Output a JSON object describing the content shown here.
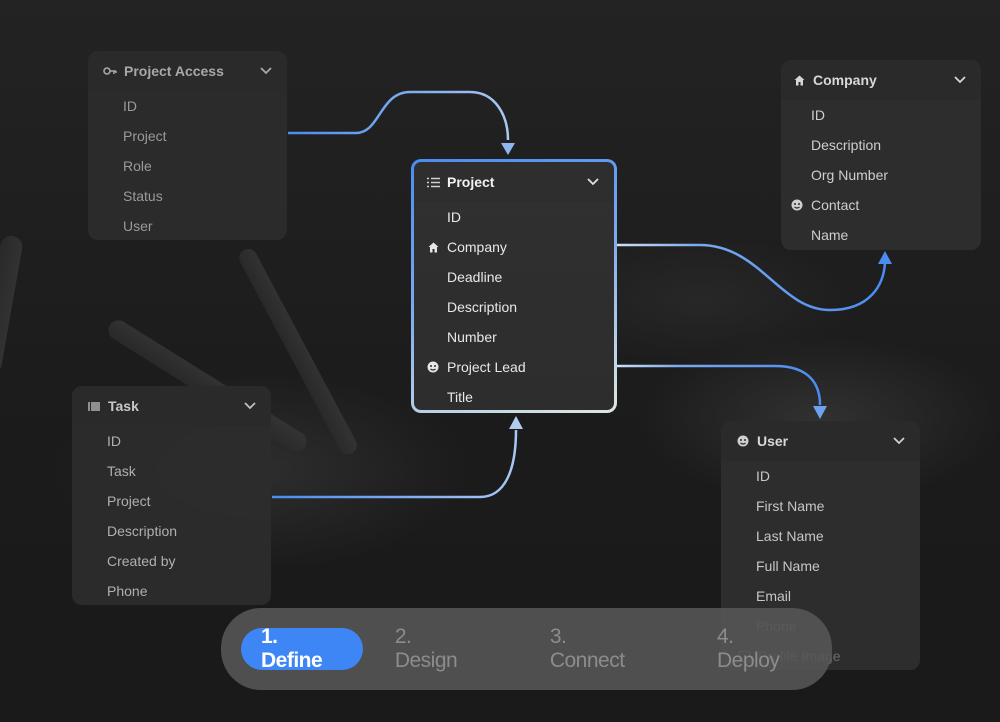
{
  "colors": {
    "accent": "#3e86f5",
    "wire": "#5b95f0",
    "background": "#1e1e1e",
    "card": "#2d2d2d"
  },
  "cards": {
    "project_access": {
      "title": "Project Access",
      "icon": "key-icon",
      "fields": [
        "ID",
        "Project",
        "Role",
        "Status",
        "User"
      ]
    },
    "project": {
      "title": "Project",
      "icon": "list-icon",
      "fields": [
        {
          "label": "ID",
          "icon": ""
        },
        {
          "label": "Company",
          "icon": "home-icon"
        },
        {
          "label": "Deadline",
          "icon": ""
        },
        {
          "label": "Description",
          "icon": ""
        },
        {
          "label": "Number",
          "icon": ""
        },
        {
          "label": "Project Lead",
          "icon": "user-face-icon"
        },
        {
          "label": "Title",
          "icon": ""
        }
      ]
    },
    "company": {
      "title": "Company",
      "icon": "home-icon",
      "fields": [
        {
          "label": "ID",
          "icon": ""
        },
        {
          "label": "Description",
          "icon": ""
        },
        {
          "label": "Org Number",
          "icon": ""
        },
        {
          "label": "Contact",
          "icon": "user-face-icon"
        },
        {
          "label": "Name",
          "icon": ""
        }
      ]
    },
    "task": {
      "title": "Task",
      "icon": "table-icon",
      "fields": [
        "ID",
        "Task",
        "Project",
        "Description",
        "Created by",
        "Phone"
      ]
    },
    "user": {
      "title": "User",
      "icon": "user-face-icon",
      "fields": [
        "ID",
        "First Name",
        "Last Name",
        "Full Name",
        "Email",
        "Phone",
        "Profile Image"
      ]
    }
  },
  "stepper": {
    "steps": [
      {
        "label": "1. Define",
        "active": true
      },
      {
        "label": "2. Design",
        "active": false
      },
      {
        "label": "3. Connect",
        "active": false
      },
      {
        "label": "4. Deploy",
        "active": false
      }
    ]
  }
}
